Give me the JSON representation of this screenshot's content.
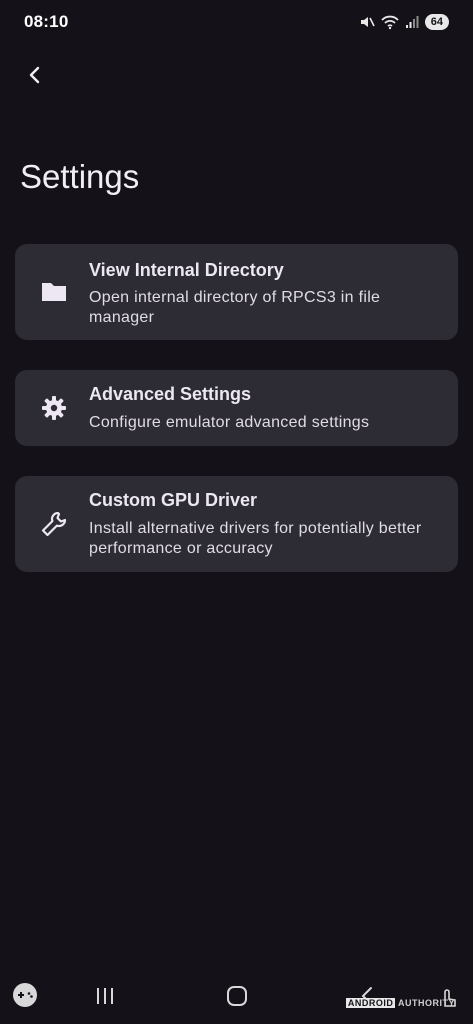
{
  "status_bar": {
    "time": "08:10",
    "icons": [
      "mute-icon",
      "wifi-icon",
      "signal-icon"
    ],
    "battery": "64"
  },
  "toolbar": {
    "back_icon": "chevron-left-icon"
  },
  "page": {
    "title": "Settings"
  },
  "settings_items": [
    {
      "icon": "folder-icon",
      "title": "View Internal Directory",
      "description": "Open internal directory of RPCS3 in file manager"
    },
    {
      "icon": "gear-icon",
      "title": "Advanced Settings",
      "description": "Configure emulator advanced settings"
    },
    {
      "icon": "wrench-icon",
      "title": "Custom GPU Driver",
      "description": "Install alternative drivers for potentially better performance or accuracy"
    }
  ],
  "nav_bar": {
    "icons": [
      "gamepad-icon",
      "recents-icon",
      "home-icon",
      "back-icon",
      "touch-icon"
    ]
  },
  "watermark": {
    "part1": "ANDROID",
    "part2": "AUTHORITY"
  },
  "colors": {
    "background": "#141218",
    "card": "#2d2b33",
    "text": "#ece7f2"
  }
}
